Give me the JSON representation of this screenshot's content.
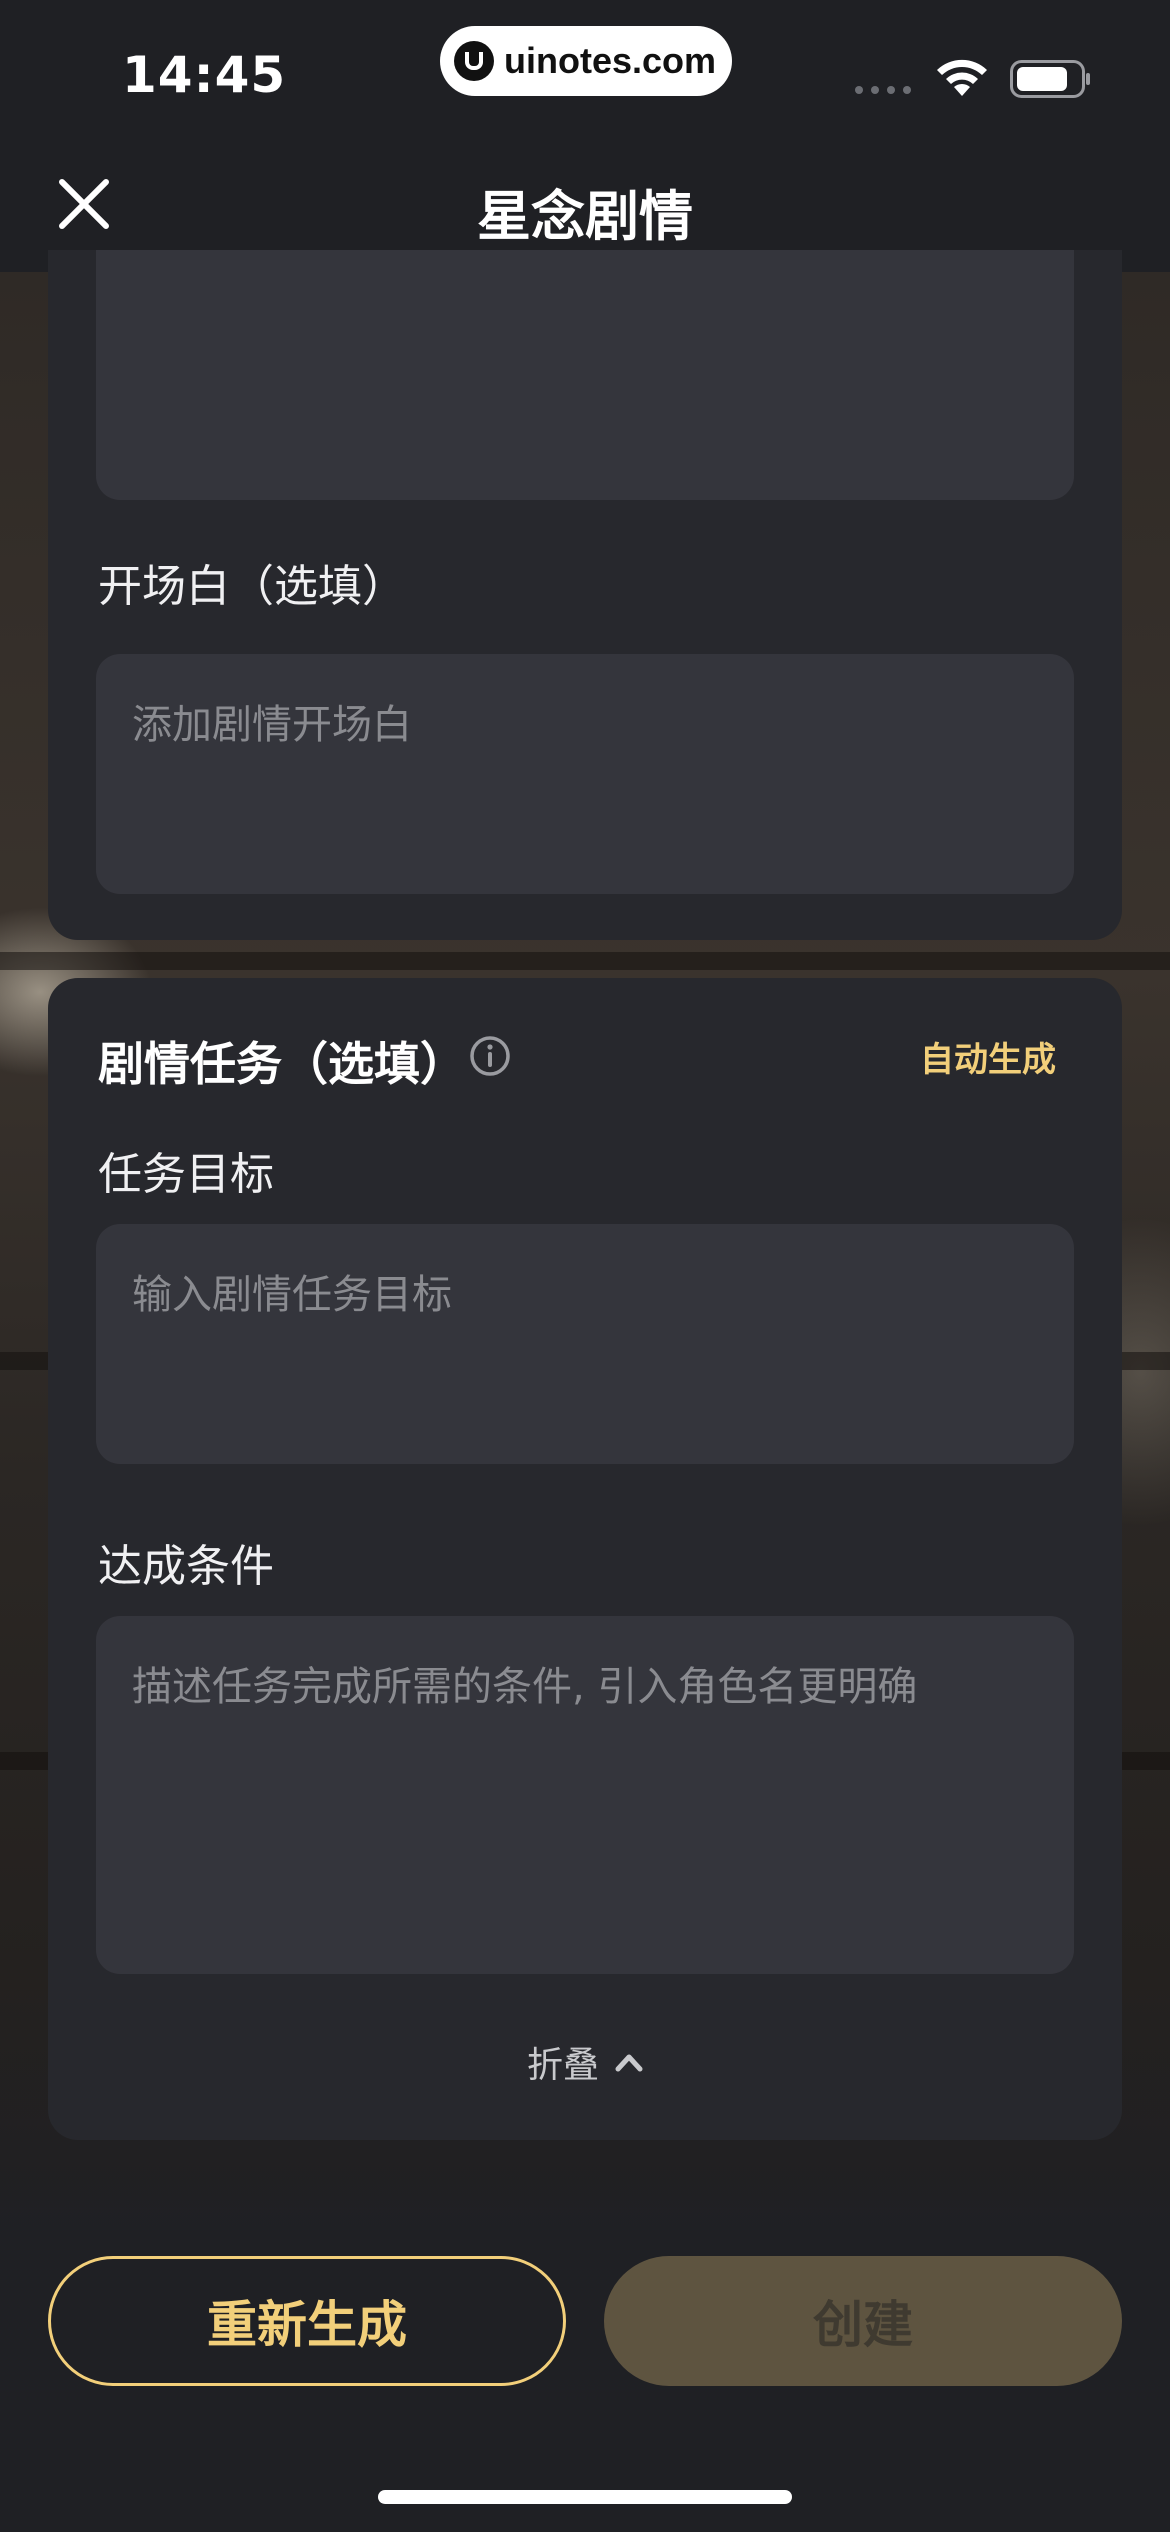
{
  "status_bar": {
    "time": "14:45",
    "url": "uinotes.com",
    "icons": [
      "signal-dots-icon",
      "wifi-icon",
      "battery-icon"
    ]
  },
  "nav": {
    "title": "星念剧情",
    "close_icon": "close-icon"
  },
  "opening_section": {
    "label": "开场白（选填）",
    "placeholder": "添加剧情开场白"
  },
  "task_section": {
    "title": "剧情任务（选填）",
    "info_icon": "info-icon",
    "auto_generate": "自动生成",
    "goal_label": "任务目标",
    "goal_placeholder": "输入剧情任务目标",
    "condition_label": "达成条件",
    "condition_placeholder": "描述任务完成所需的条件, 引入角色名更明确",
    "collapse_label": "折叠"
  },
  "actions": {
    "regenerate": "重新生成",
    "create": "创建"
  },
  "colors": {
    "accent": "#f2cf7a",
    "background": "#1f2024",
    "card": "#27282d",
    "input": "#34353c",
    "create_disabled": "#5e5440"
  }
}
